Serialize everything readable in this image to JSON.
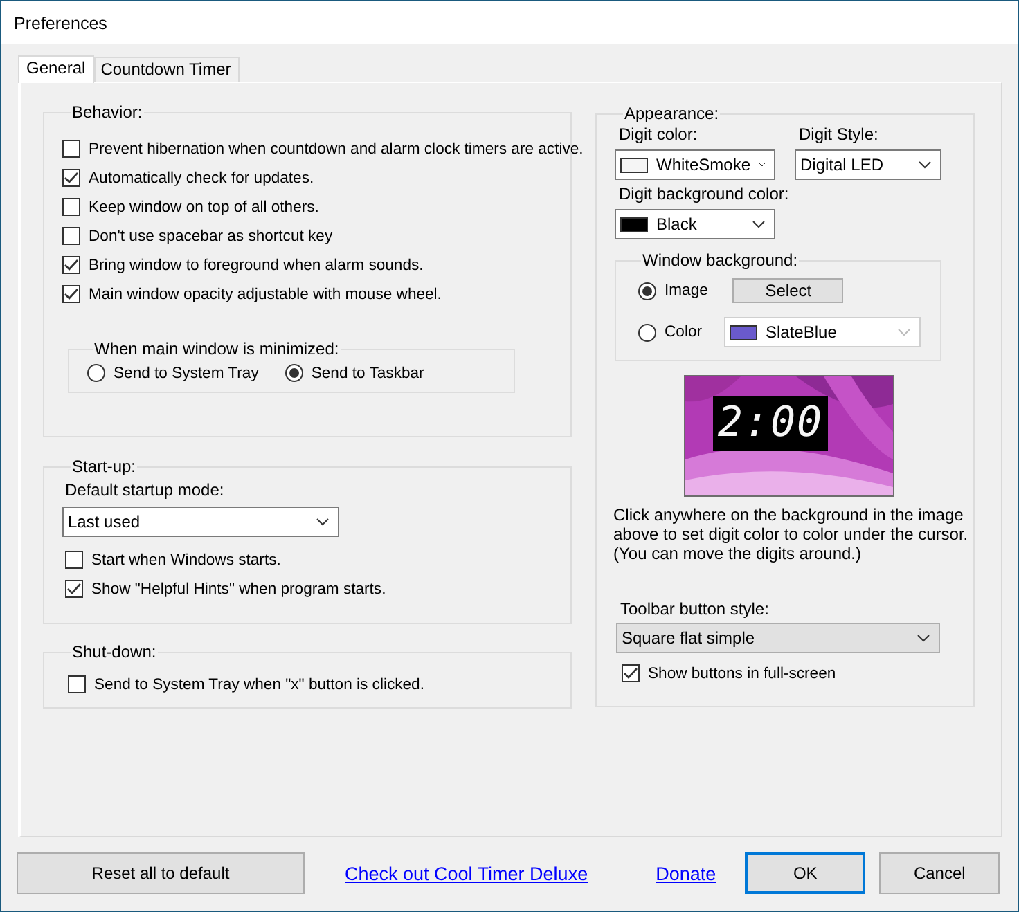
{
  "window": {
    "title": "Preferences"
  },
  "tabs": [
    {
      "label": "General",
      "selected": true
    },
    {
      "label": "Countdown Timer",
      "selected": false
    }
  ],
  "behavior": {
    "title": "Behavior:",
    "options": [
      {
        "label": "Prevent hibernation when countdown and alarm clock timers are active.",
        "checked": false
      },
      {
        "label": "Automatically check for updates.",
        "checked": true
      },
      {
        "label": "Keep window on top of all others.",
        "checked": false
      },
      {
        "label": "Don't use spacebar as shortcut key",
        "checked": false
      },
      {
        "label": "Bring window to foreground when alarm sounds.",
        "checked": true
      },
      {
        "label": "Main window opacity adjustable with mouse wheel.",
        "checked": true
      }
    ],
    "minimized": {
      "title": "When main window is minimized:",
      "options": [
        {
          "label": "Send to System Tray",
          "selected": false
        },
        {
          "label": "Send to Taskbar",
          "selected": true
        }
      ]
    }
  },
  "startup": {
    "title": "Start-up:",
    "mode_label": "Default startup mode:",
    "mode_value": "Last used",
    "options": [
      {
        "label": "Start when Windows starts.",
        "checked": false
      },
      {
        "label": "Show \"Helpful Hints\" when program starts.",
        "checked": true
      }
    ]
  },
  "shutdown": {
    "title": "Shut-down:",
    "options": [
      {
        "label": "Send to System Tray when \"x\" button is clicked.",
        "checked": false
      }
    ]
  },
  "appearance": {
    "title": "Appearance:",
    "digit_color": {
      "label": "Digit color:",
      "value": "WhiteSmoke",
      "color": "#f5f5f5"
    },
    "digit_style": {
      "label": "Digit Style:",
      "value": "Digital LED"
    },
    "digit_background": {
      "label": "Digit background color:",
      "value": "Black",
      "color": "#000000"
    },
    "window_background": {
      "title": "Window background:",
      "options": [
        {
          "kind": "button",
          "label": "Image",
          "selected": true,
          "button": "Select"
        },
        {
          "kind": "dropdown",
          "label": "Color",
          "selected": false,
          "value": "SlateBlue",
          "color": "#6a5acd",
          "disabled": true
        }
      ]
    },
    "preview": {
      "digits": "2:00"
    },
    "hint": "Click anywhere on the background in the image above to set digit color to color under the cursor. (You can move the digits around.)",
    "toolbar_label": "Toolbar button style:",
    "toolbar_value": "Square flat simple",
    "options": [
      {
        "label": "Show buttons in full-screen",
        "checked": true
      }
    ]
  },
  "footer": [
    {
      "kind": "button",
      "label": "Reset all to default",
      "focused": false
    },
    {
      "kind": "link",
      "label": "Check out Cool Timer Deluxe"
    },
    {
      "kind": "link",
      "label": "Donate"
    },
    {
      "kind": "button",
      "label": "OK",
      "focused": true
    },
    {
      "kind": "button",
      "label": "Cancel",
      "focused": false
    }
  ]
}
